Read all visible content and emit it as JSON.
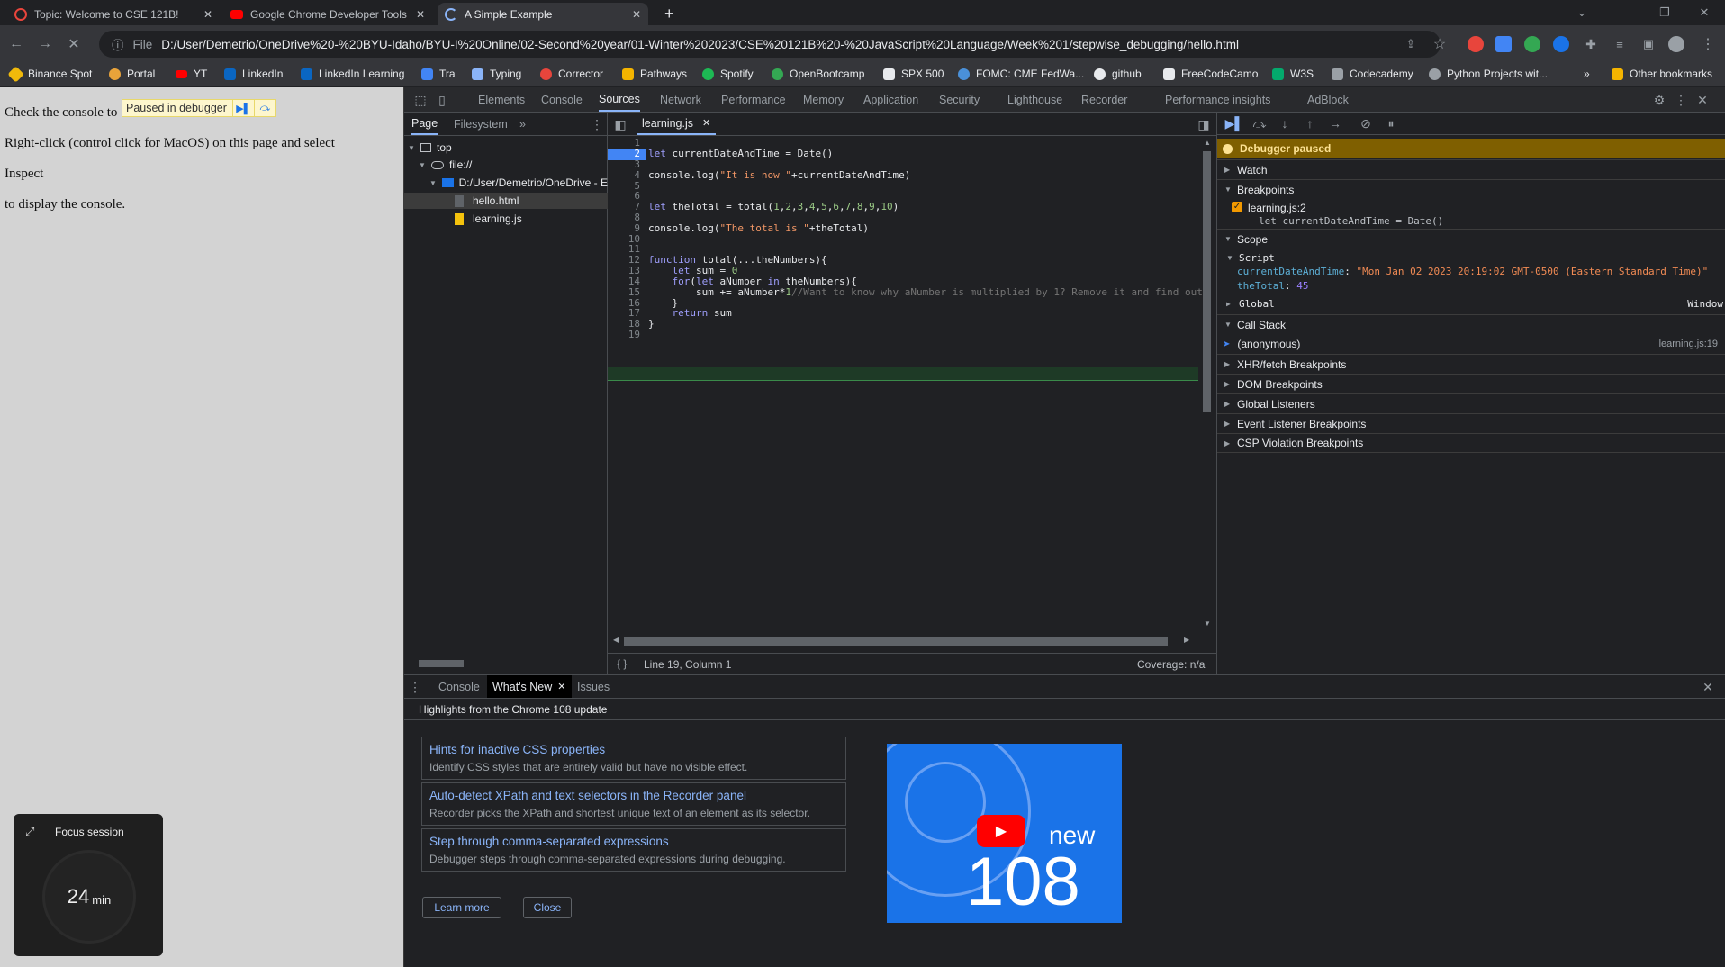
{
  "browser": {
    "tabs": [
      {
        "title": "Topic: Welcome to CSE 121B!",
        "icon": "discourse-icon",
        "color": "#e8453c"
      },
      {
        "title": "Google Chrome Developer Tools",
        "icon": "youtube-icon",
        "color": "#ff0000"
      },
      {
        "title": "A Simple Example",
        "icon": "loading-icon",
        "color": "#8ab4f8"
      }
    ],
    "new_tab": "+",
    "address_prefix": "File",
    "address": "D:/User/Demetrio/OneDrive%20-%20BYU-Idaho/BYU-I%20Online/02-Second%20year/01-Winter%202023/CSE%20121B%20-%20JavaScript%20Language/Week%201/stepwise_debugging/hello.html",
    "bookmarks": [
      {
        "label": "Binance Spot",
        "color": "#f0b90b"
      },
      {
        "label": "Portal",
        "color": "#e8a33a"
      },
      {
        "label": "YT",
        "color": "#ff0000"
      },
      {
        "label": "LinkedIn",
        "color": "#0a66c2"
      },
      {
        "label": "LinkedIn Learning",
        "color": "#0a66c2"
      },
      {
        "label": "Tra",
        "color": "#4285f4"
      },
      {
        "label": "Typing",
        "color": "#8ab4f8"
      },
      {
        "label": "Corrector",
        "color": "#e8453c"
      },
      {
        "label": "Pathways",
        "color": "#f4b400"
      },
      {
        "label": "Spotify",
        "color": "#1db954"
      },
      {
        "label": "OpenBootcamp",
        "color": "#34a853"
      },
      {
        "label": "SPX 500",
        "color": "#e8eaed"
      },
      {
        "label": "FOMC: CME FedWa...",
        "color": "#4a90d9"
      },
      {
        "label": "github",
        "color": "#e8eaed"
      },
      {
        "label": "FreeCodeCamo",
        "color": "#e8eaed"
      },
      {
        "label": "W3S",
        "color": "#04aa6d"
      },
      {
        "label": "Codecademy",
        "color": "#9aa0a6"
      },
      {
        "label": "Python Projects wit...",
        "color": "#9aa0a6"
      }
    ],
    "bookmarks_more": "»",
    "other_bookmarks": "Other bookmarks"
  },
  "page": {
    "line1": "Check the console to",
    "line2": "Right-click (control click for MacOS) on this page and select",
    "line3": "Inspect",
    "line4": "to display the console.",
    "paused_badge": "Paused in debugger"
  },
  "focus": {
    "title": "Focus session",
    "minutes": "24",
    "unit": "min"
  },
  "devtools": {
    "tabs": [
      "Elements",
      "Console",
      "Sources",
      "Network",
      "Performance",
      "Memory",
      "Application",
      "Security",
      "Lighthouse",
      "Recorder",
      "Performance insights",
      "AdBlock"
    ],
    "active_tab": "Sources",
    "navigator": {
      "tabs": [
        "Page",
        "Filesystem"
      ],
      "more": "»",
      "tree": [
        "top",
        "file://",
        "D:/User/Demetrio/OneDrive - E",
        "hello.html",
        "learning.js"
      ]
    },
    "editor": {
      "file_tab": "learning.js",
      "status_position": "Line 19, Column 1",
      "status_coverage": "Coverage: n/a",
      "line_numbers": [
        "1",
        "2",
        "3",
        "4",
        "5",
        "6",
        "7",
        "8",
        "9",
        "10",
        "11",
        "12",
        "13",
        "14",
        "15",
        "16",
        "17",
        "18",
        "19"
      ],
      "breakpoint_line": "2"
    },
    "sidebar": {
      "paused_banner": "Debugger paused",
      "watch": "Watch",
      "breakpoints": "Breakpoints",
      "bp_file": "learning.js:2",
      "bp_code": "let currentDateAndTime = Date()",
      "scope": "Scope",
      "script": "Script",
      "var1_name": "currentDateAndTime",
      "var1_value": "\"Mon Jan 02 2023 20:19:02 GMT-0500 (Eastern Standard Time)\"",
      "var2_name": "theTotal",
      "var2_value": "45",
      "global": "Global",
      "global_value": "Window",
      "call_stack": "Call Stack",
      "frame_name": "(anonymous)",
      "frame_loc": "learning.js:19",
      "xhr": "XHR/fetch Breakpoints",
      "dom": "DOM Breakpoints",
      "listeners": "Global Listeners",
      "event_listeners": "Event Listener Breakpoints",
      "csp": "CSP Violation Breakpoints"
    },
    "drawer": {
      "tabs": [
        "Console",
        "What's New",
        "Issues"
      ],
      "headline": "Highlights from the Chrome 108 update",
      "cards": [
        {
          "title": "Hints for inactive CSS properties",
          "desc": "Identify CSS styles that are entirely valid but have no visible effect."
        },
        {
          "title": "Auto-detect XPath and text selectors in the Recorder panel",
          "desc": "Recorder picks the XPath and shortest unique text of an element as its selector."
        },
        {
          "title": "Step through comma-separated expressions",
          "desc": "Debugger steps through comma-separated expressions during debugging."
        }
      ],
      "learn_more": "Learn more",
      "close": "Close",
      "video_word": "new",
      "video_version": "108"
    }
  }
}
